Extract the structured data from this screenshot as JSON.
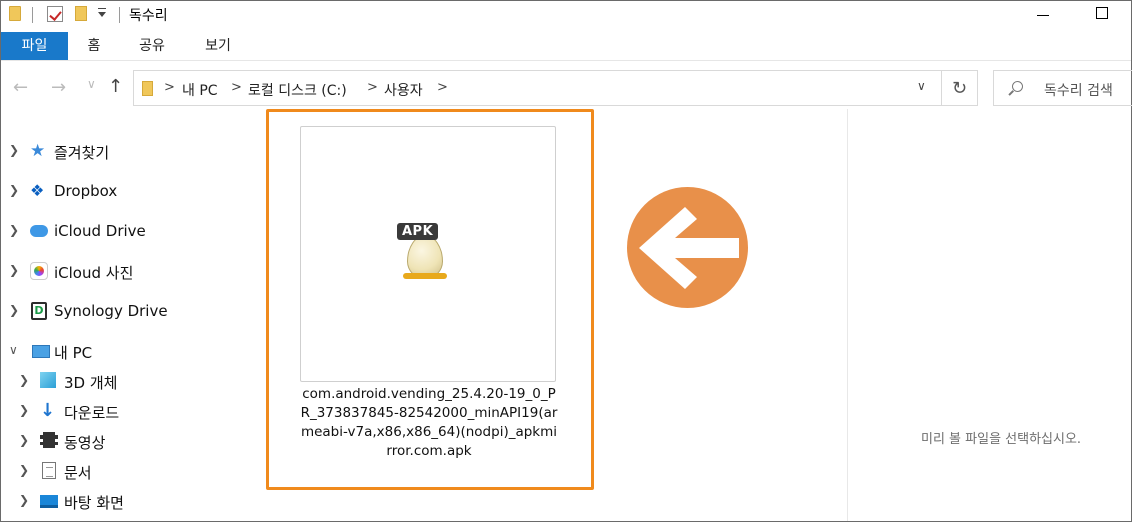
{
  "window": {
    "title": "독수리"
  },
  "ribbon": {
    "tabs": [
      {
        "label": "파일",
        "active": true
      },
      {
        "label": "홈"
      },
      {
        "label": "공유"
      },
      {
        "label": "보기"
      }
    ]
  },
  "address": {
    "breadcrumbs": [
      "내 PC",
      "로컬 디스크 (C:)",
      "사용자"
    ],
    "separator": ">"
  },
  "search": {
    "placeholder": "독수리 검색"
  },
  "sidebar": {
    "items": [
      {
        "label": "즐겨찾기",
        "icon": "star-icon",
        "expanded": false
      },
      {
        "label": "Dropbox",
        "icon": "dropbox-icon",
        "expanded": false
      },
      {
        "label": "iCloud Drive",
        "icon": "icloud-icon",
        "expanded": false
      },
      {
        "label": "iCloud 사진",
        "icon": "photos-icon",
        "expanded": false
      },
      {
        "label": "Synology Drive",
        "icon": "synology-icon",
        "expanded": false
      },
      {
        "label": "내 PC",
        "icon": "pc-icon",
        "expanded": true
      },
      {
        "label": "3D 개체",
        "icon": "3d-objects-icon",
        "expanded": false
      },
      {
        "label": "다운로드",
        "icon": "download-icon",
        "expanded": false
      },
      {
        "label": "동영상",
        "icon": "video-icon",
        "expanded": false
      },
      {
        "label": "문서",
        "icon": "document-icon",
        "expanded": false
      },
      {
        "label": "바탕 화면",
        "icon": "desktop-icon",
        "expanded": false
      }
    ]
  },
  "content": {
    "file": {
      "icon_badge": "APK",
      "name": "com.android.vending_25.4.20-19_0_PR_373837845-82542000_minAPI19(armeabi-v7a,x86,x86_64)(nodpi)_apkmirror.com.apk"
    },
    "preview_message": "미리 볼 파일을 선택하십시오."
  },
  "colors": {
    "accent": "#1979ca",
    "highlight": "#f08a1c",
    "arrow": "#e8904a"
  }
}
